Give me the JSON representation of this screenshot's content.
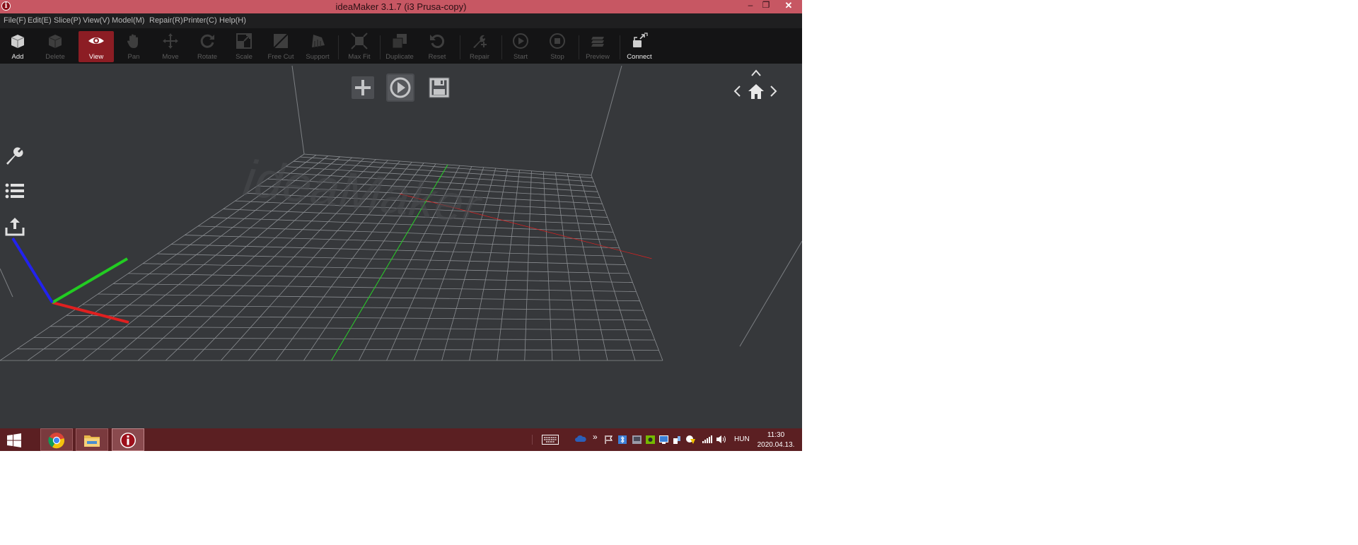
{
  "window": {
    "title": "ideaMaker 3.1.7 (i3 Prusa-copy)",
    "app_icon_letter": "i",
    "minimize_glyph": "–",
    "restore_glyph": "❐",
    "close_glyph": "✕"
  },
  "menu": [
    {
      "id": "file",
      "label": "File(F)"
    },
    {
      "id": "edit",
      "label": "Edit(E)"
    },
    {
      "id": "slice",
      "label": "Slice(P)"
    },
    {
      "id": "view",
      "label": "View(V)"
    },
    {
      "id": "model",
      "label": "Model(M)"
    },
    {
      "id": "repair",
      "label": "Repair(R)"
    },
    {
      "id": "printer",
      "label": "Printer(C)"
    },
    {
      "id": "help",
      "label": "Help(H)"
    }
  ],
  "toolbar": [
    {
      "id": "add",
      "label": "Add",
      "icon": "add-cube-icon",
      "state": "enabled"
    },
    {
      "id": "delete",
      "label": "Delete",
      "icon": "delete-cube-icon",
      "state": "disabled"
    },
    {
      "id": "view",
      "label": "View",
      "icon": "eye-icon",
      "state": "active"
    },
    {
      "id": "pan",
      "label": "Pan",
      "icon": "hand-icon",
      "state": "disabled"
    },
    {
      "id": "move",
      "label": "Move",
      "icon": "move-arrows-icon",
      "state": "disabled"
    },
    {
      "id": "rotate",
      "label": "Rotate",
      "icon": "rotate-icon",
      "state": "disabled"
    },
    {
      "id": "scale",
      "label": "Scale",
      "icon": "scale-icon",
      "state": "disabled"
    },
    {
      "id": "free-cut",
      "label": "Free Cut",
      "icon": "free-cut-icon",
      "state": "disabled"
    },
    {
      "id": "support",
      "label": "Support",
      "icon": "support-icon",
      "state": "disabled"
    },
    {
      "id": "max-fit",
      "label": "Max Fit",
      "icon": "max-fit-icon",
      "state": "disabled"
    },
    {
      "id": "duplicate",
      "label": "Duplicate",
      "icon": "duplicate-icon",
      "state": "disabled"
    },
    {
      "id": "reset",
      "label": "Reset",
      "icon": "reset-icon",
      "state": "disabled"
    },
    {
      "id": "repair",
      "label": "Repair",
      "icon": "wrench-plus-icon",
      "state": "disabled"
    },
    {
      "id": "start",
      "label": "Start",
      "icon": "play-circle-icon",
      "state": "disabled"
    },
    {
      "id": "stop",
      "label": "Stop",
      "icon": "stop-circle-icon",
      "state": "disabled"
    },
    {
      "id": "preview",
      "label": "Preview",
      "icon": "preview-layers-icon",
      "state": "disabled"
    },
    {
      "id": "connect",
      "label": "Connect",
      "icon": "connect-icon",
      "state": "enabled"
    }
  ],
  "viewport": {
    "watermark": "ideaMaker",
    "quick_buttons": [
      "add-plus-icon",
      "play-slice-icon",
      "save-floppy-icon"
    ],
    "side_tools": [
      "wrench-icon",
      "list-icon",
      "upload-icon"
    ],
    "nav": [
      "nav-up-icon",
      "nav-left-icon",
      "home-icon",
      "nav-right-icon"
    ],
    "axis_colors": {
      "x": "#e02020",
      "y": "#22cc22",
      "z": "#2222ee"
    }
  },
  "taskbar": {
    "language": "HUN",
    "time": "11:30",
    "date": "2020.04.13.",
    "overflow_glyph": "»",
    "apps": [
      "windows-start-icon",
      "chrome-icon",
      "file-explorer-icon",
      "ideamaker-icon"
    ]
  },
  "colors": {
    "titlebar": "#c75763",
    "accent": "#8c1d24",
    "taskbar": "#5b1f22",
    "viewport": "#36383b"
  }
}
